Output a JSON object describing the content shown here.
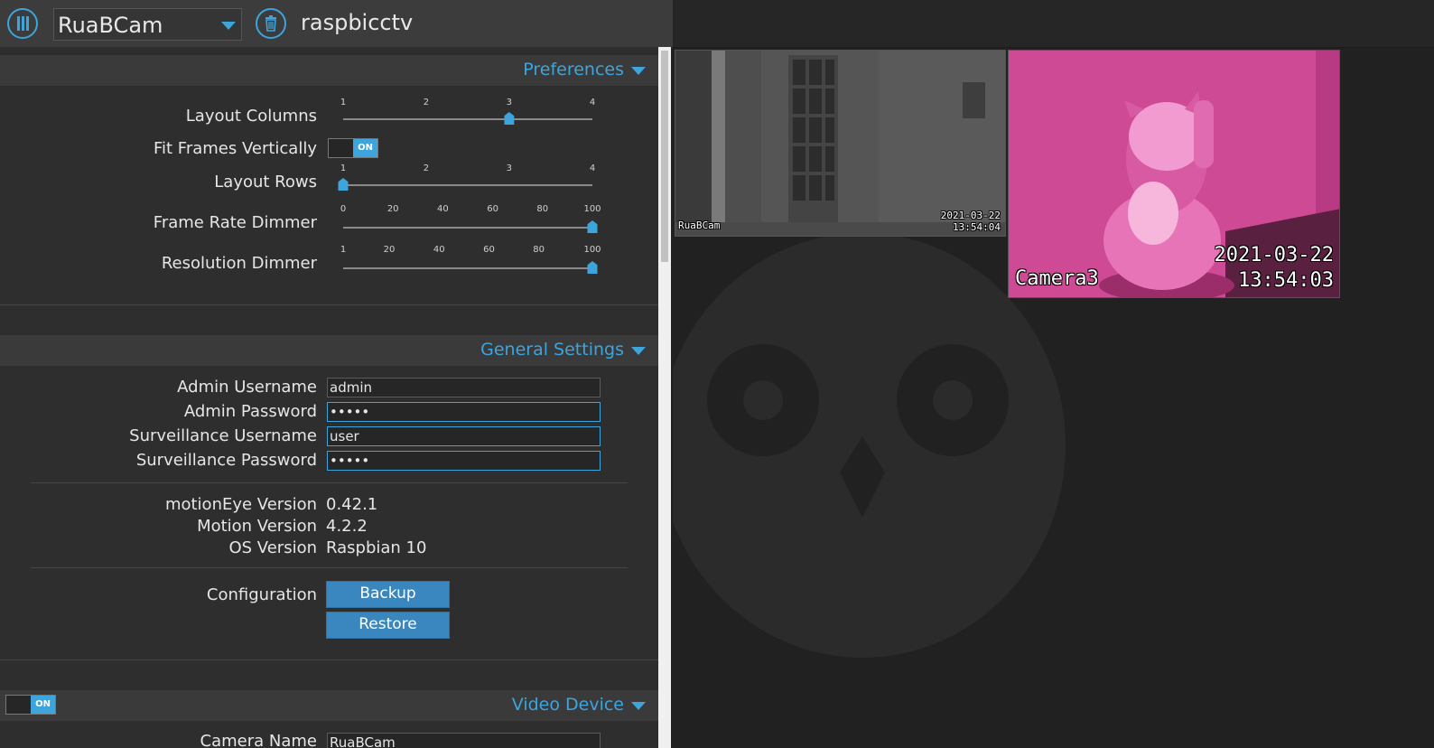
{
  "header": {
    "camera_select_value": "RuaBCam",
    "hostname": "raspbicctv"
  },
  "preferences": {
    "title": "Preferences",
    "layout_columns": {
      "label": "Layout Columns",
      "ticks": [
        "1",
        "2",
        "3",
        "4"
      ],
      "value": 3
    },
    "fit_frames_vertically": {
      "label": "Fit Frames Vertically",
      "state": "ON"
    },
    "layout_rows": {
      "label": "Layout Rows",
      "ticks": [
        "1",
        "2",
        "3",
        "4"
      ],
      "value": 1
    },
    "frame_rate_dimmer": {
      "label": "Frame Rate Dimmer",
      "ticks": [
        "0",
        "20",
        "40",
        "60",
        "80",
        "100"
      ],
      "value": 100
    },
    "resolution_dimmer": {
      "label": "Resolution Dimmer",
      "ticks": [
        "1",
        "20",
        "40",
        "60",
        "80",
        "100"
      ],
      "value": 100
    }
  },
  "general_settings": {
    "title": "General Settings",
    "admin_username": {
      "label": "Admin Username",
      "value": "admin"
    },
    "admin_password": {
      "label": "Admin Password",
      "value": "•••••"
    },
    "surveillance_username": {
      "label": "Surveillance Username",
      "value": "user"
    },
    "surveillance_password": {
      "label": "Surveillance Password",
      "value": "•••••"
    },
    "motioneye_version": {
      "label": "motionEye Version",
      "value": "0.42.1"
    },
    "motion_version": {
      "label": "Motion Version",
      "value": "4.2.2"
    },
    "os_version": {
      "label": "OS Version",
      "value": "Raspbian 10"
    },
    "configuration": {
      "label": "Configuration",
      "backup": "Backup",
      "restore": "Restore"
    }
  },
  "video_device": {
    "title": "Video Device",
    "enabled_state": "ON",
    "camera_name_label": "Camera Name",
    "camera_name_value": "RuaBCam"
  },
  "cameras": [
    {
      "name": "RuaBCam",
      "date": "2021-03-22",
      "time": "13:54:04"
    },
    {
      "name": "Camera3",
      "date": "2021-03-22",
      "time": "13:54:03"
    }
  ],
  "colors": {
    "accent": "#3da5dc",
    "panel": "#2e2e2e",
    "background": "#212121"
  }
}
